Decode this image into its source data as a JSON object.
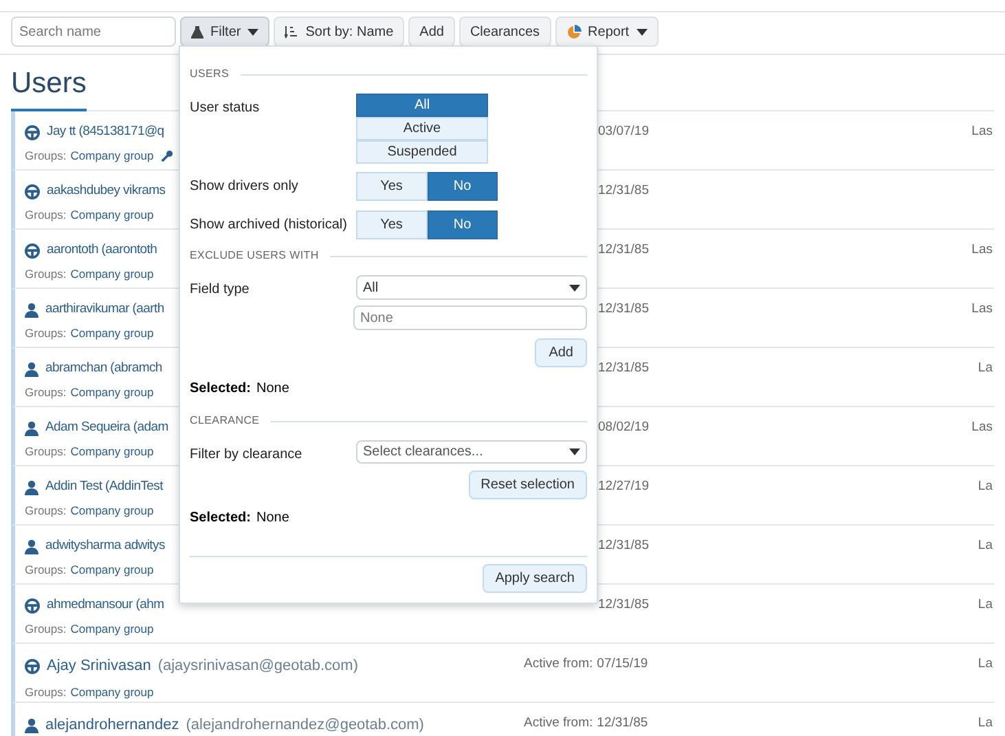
{
  "toolbar": {
    "search": {
      "placeholder": "Search name"
    },
    "buttons": [
      {
        "kind": "filter",
        "label": "Filter",
        "caret": true,
        "open": true
      },
      {
        "kind": "sort",
        "label": "Sort by: Name",
        "caret": false,
        "open": false
      },
      {
        "kind": "plain",
        "label": "Add",
        "caret": false,
        "open": false
      },
      {
        "kind": "plain",
        "label": "Clearances",
        "caret": false,
        "open": false
      },
      {
        "kind": "report",
        "label": "Report",
        "caret": true,
        "open": false
      }
    ]
  },
  "page_title": "Users",
  "users": [
    {
      "kind": "driver",
      "name": "Jay tt (845138171@q",
      "groups_label": "Groups:",
      "group": "Company group",
      "wrench": true,
      "active_date": "03/07/19",
      "last": "Las"
    },
    {
      "kind": "driver",
      "name": "aakashdubey vikrams",
      "groups_label": "Groups:",
      "group": "Company group",
      "wrench": false,
      "active_date": "12/31/85"
    },
    {
      "kind": "driver",
      "name": "aarontoth (aarontoth",
      "groups_label": "Groups:",
      "group": "Company group",
      "wrench": false,
      "active_date": "12/31/85",
      "last": "Las"
    },
    {
      "kind": "user",
      "name": "aarthiravikumar (aarth",
      "groups_label": "Groups:",
      "group": "Company group",
      "wrench": false,
      "active_date": "12/31/85",
      "last": "Las"
    },
    {
      "kind": "user",
      "name": "abramchan (abramch",
      "groups_label": "Groups:",
      "group": "Company group",
      "wrench": false,
      "active_date": "12/31/85",
      "last": "La"
    },
    {
      "kind": "user",
      "name": "Adam Sequeira (adam",
      "groups_label": "Groups:",
      "group": "Company group",
      "wrench": false,
      "active_date": "08/02/19",
      "last": "Las"
    },
    {
      "kind": "user",
      "name": "Addin Test (AddinTest",
      "groups_label": "Groups:",
      "group": "Company group",
      "wrench": false,
      "active_date": "12/27/19",
      "last": "La"
    },
    {
      "kind": "user",
      "name": "adwitysharma adwitys",
      "groups_label": "Groups:",
      "group": "Company group",
      "wrench": false,
      "active_date": "12/31/85",
      "last": "La"
    },
    {
      "kind": "driver",
      "name": "ahmedmansour (ahm",
      "groups_label": "Groups:",
      "group": "Company group",
      "wrench": false,
      "active_date": "12/31/85",
      "last": "La"
    },
    {
      "kind": "driver",
      "name": "Ajay Srinivasan",
      "email": "(ajaysrinivasan@geotab.com)",
      "groups_label": "Groups:",
      "group": "Company group",
      "wrench": false,
      "active_label": "Active from:",
      "active_date": "07/15/19",
      "last": "La"
    },
    {
      "kind": "user",
      "name": "alejandrohernandez",
      "email": "(alejandrohernandez@geotab.com)",
      "wrench": false,
      "active_label": "Active from:",
      "active_date": "12/31/85",
      "last": "La"
    }
  ],
  "filter_panel": {
    "users_section": {
      "heading": "USERS",
      "user_status": {
        "label": "User status",
        "options": [
          {
            "label": "All",
            "selected": true
          },
          {
            "label": "Active",
            "selected": false
          },
          {
            "label": "Suspended",
            "selected": false
          }
        ]
      },
      "drivers_only": {
        "label": "Show drivers only",
        "options": [
          {
            "label": "Yes",
            "selected": false
          },
          {
            "label": "No",
            "selected": true
          }
        ]
      },
      "archived": {
        "label": "Show archived (historical)",
        "options": [
          {
            "label": "Yes",
            "selected": false
          },
          {
            "label": "No",
            "selected": true
          }
        ]
      }
    },
    "exclude_section": {
      "heading": "EXCLUDE USERS WITH",
      "field_type": {
        "label": "Field type",
        "value": "All"
      },
      "value_field": {
        "placeholder": "None"
      },
      "add_button": "Add",
      "selected_label": "Selected:",
      "selected_value": "None"
    },
    "clearance_section": {
      "heading": "CLEARANCE",
      "filter": {
        "label": "Filter by clearance",
        "placeholder": "Select clearances..."
      },
      "reset_button": "Reset selection",
      "selected_label": "Selected:",
      "selected_value": "None"
    },
    "apply_button": "Apply search"
  }
}
